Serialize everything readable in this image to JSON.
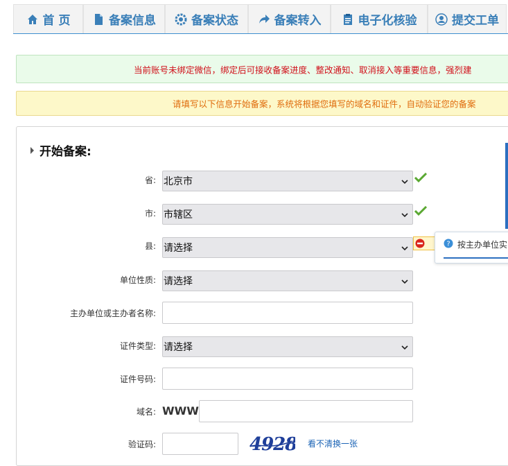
{
  "nav": {
    "tabs": [
      {
        "label": "首 页",
        "icon": "home-icon"
      },
      {
        "label": "备案信息",
        "icon": "document-icon"
      },
      {
        "label": "备案状态",
        "icon": "gear-icon"
      },
      {
        "label": "备案转入",
        "icon": "forward-arrow-icon"
      },
      {
        "label": "电子化核验",
        "icon": "clipboard-icon"
      },
      {
        "label": "提交工单",
        "icon": "user-icon"
      }
    ]
  },
  "alerts": {
    "wechat": "当前账号未绑定微信，绑定后可接收备案进度、整改通知、取消接入等重要信息，强烈建",
    "info": "请填写以下信息开始备案，系统将根据您填写的域名和证件，自动验证您的备案"
  },
  "form": {
    "title": "开始备案:",
    "province": {
      "label": "省:",
      "value": "北京市"
    },
    "city": {
      "label": "市:",
      "value": "市辖区"
    },
    "county": {
      "label": "县:",
      "value": "请选择"
    },
    "unit_type": {
      "label": "单位性质:",
      "value": "请选择"
    },
    "sponsor_name": {
      "label": "主办单位或主办者名称:",
      "value": ""
    },
    "cert_type": {
      "label": "证件类型:",
      "value": "请选择"
    },
    "cert_number": {
      "label": "证件号码:",
      "value": ""
    },
    "domain": {
      "label": "域名:",
      "prefix": "WWW.",
      "value": ""
    },
    "captcha": {
      "label": "验证码:",
      "value": "",
      "image_text": "4928",
      "refresh_label": "看不清换一张"
    },
    "tooltip": "按主办单位实际"
  },
  "colors": {
    "nav_text": "#3a7fb8",
    "accent": "#2c6fc0",
    "alert_red": "#d0101a",
    "alert_orange": "#e06d0e",
    "success": "#5aa832"
  }
}
